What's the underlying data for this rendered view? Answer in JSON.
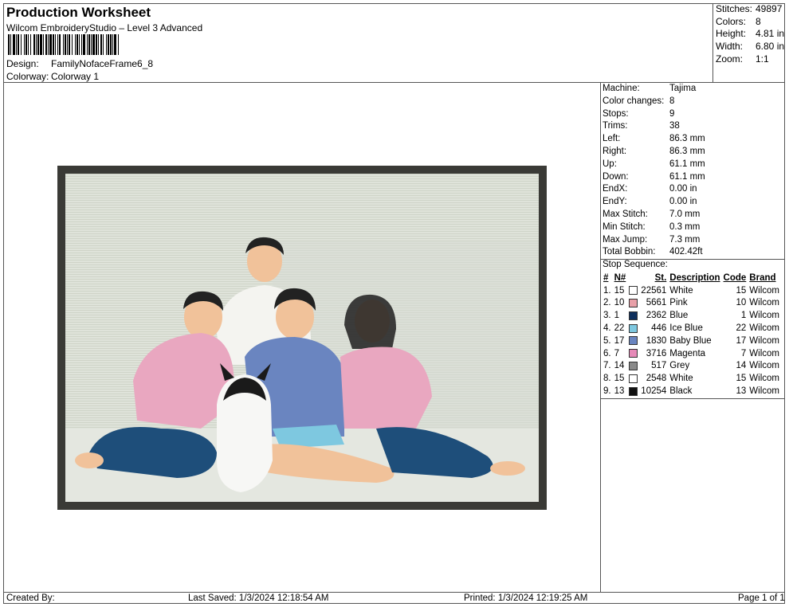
{
  "header": {
    "title": "Production Worksheet",
    "software": "Wilcom EmbroideryStudio – Level 3 Advanced",
    "design_label": "Design:",
    "design_value": "FamilyNofaceFrame6_8",
    "colorway_label": "Colorway:",
    "colorway_value": "Colorway 1"
  },
  "summary": [
    {
      "label": "Stitches:",
      "value": "49897"
    },
    {
      "label": "Colors:",
      "value": "8"
    },
    {
      "label": "Height:",
      "value": "4.81 in"
    },
    {
      "label": "Width:",
      "value": "6.80 in"
    },
    {
      "label": "Zoom:",
      "value": "1:1"
    }
  ],
  "machine_info": [
    {
      "label": "Machine:",
      "value": "Tajima"
    },
    {
      "label": "Color changes:",
      "value": "8"
    },
    {
      "label": "Stops:",
      "value": "9"
    },
    {
      "label": "Trims:",
      "value": "38"
    },
    {
      "label": "Left:",
      "value": "86.3 mm"
    },
    {
      "label": "Right:",
      "value": "86.3 mm"
    },
    {
      "label": "Up:",
      "value": "61.1 mm"
    },
    {
      "label": "Down:",
      "value": "61.1 mm"
    },
    {
      "label": "EndX:",
      "value": "0.00 in"
    },
    {
      "label": "EndY:",
      "value": "0.00 in"
    },
    {
      "label": "Max Stitch:",
      "value": "7.0 mm"
    },
    {
      "label": "Min Stitch:",
      "value": "0.3 mm"
    },
    {
      "label": "Max Jump:",
      "value": "7.3 mm"
    },
    {
      "label": "Total Bobbin:",
      "value": "402.42ft"
    }
  ],
  "stop_sequence": {
    "title": "Stop Sequence:",
    "columns": [
      "#",
      "N#",
      "St.",
      "Description",
      "Code",
      "Brand"
    ],
    "rows": [
      {
        "idx": "1.",
        "n": "15",
        "color": "#ffffff",
        "st": "22561",
        "desc": "White",
        "code": "15",
        "brand": "Wilcom"
      },
      {
        "idx": "2.",
        "n": "10",
        "color": "#e8a0a8",
        "st": "5661",
        "desc": "Pink",
        "code": "10",
        "brand": "Wilcom"
      },
      {
        "idx": "3.",
        "n": "1",
        "color": "#0e2f5c",
        "st": "2362",
        "desc": "Blue",
        "code": "1",
        "brand": "Wilcom"
      },
      {
        "idx": "4.",
        "n": "22",
        "color": "#7ec8e0",
        "st": "446",
        "desc": "Ice Blue",
        "code": "22",
        "brand": "Wilcom"
      },
      {
        "idx": "5.",
        "n": "17",
        "color": "#6a85c0",
        "st": "1830",
        "desc": "Baby Blue",
        "code": "17",
        "brand": "Wilcom"
      },
      {
        "idx": "6.",
        "n": "7",
        "color": "#e68ab8",
        "st": "3716",
        "desc": "Magenta",
        "code": "7",
        "brand": "Wilcom"
      },
      {
        "idx": "7.",
        "n": "14",
        "color": "#8a8a8a",
        "st": "517",
        "desc": "Grey",
        "code": "14",
        "brand": "Wilcom"
      },
      {
        "idx": "8.",
        "n": "15",
        "color": "#ffffff",
        "st": "2548",
        "desc": "White",
        "code": "15",
        "brand": "Wilcom"
      },
      {
        "idx": "9.",
        "n": "13",
        "color": "#111111",
        "st": "10254",
        "desc": "Black",
        "code": "13",
        "brand": "Wilcom"
      }
    ]
  },
  "footer": {
    "created_by": "Created By:",
    "last_saved": "Last Saved: 1/3/2024 12:18:54 AM",
    "printed": "Printed: 1/3/2024 12:19:25 AM",
    "page": "Page 1 of 1"
  }
}
